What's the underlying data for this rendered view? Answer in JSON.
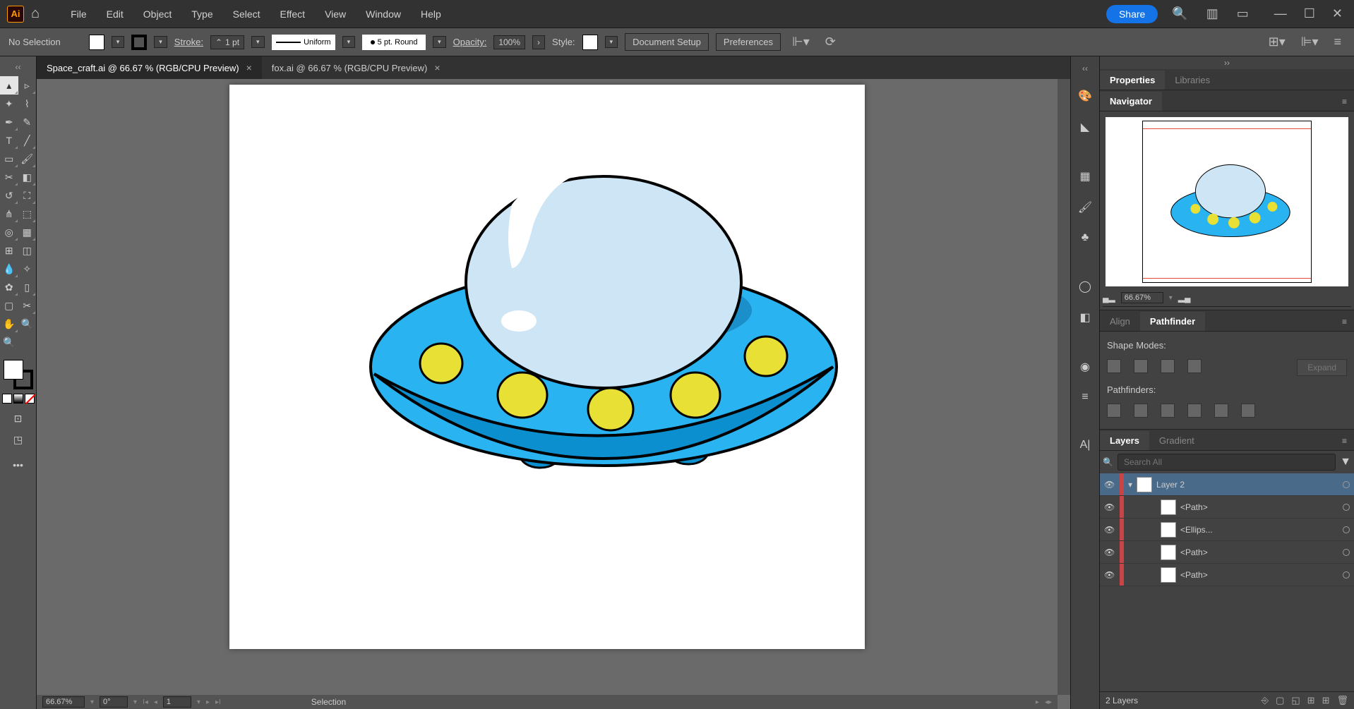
{
  "menubar": {
    "items": [
      "File",
      "Edit",
      "Object",
      "Type",
      "Select",
      "Effect",
      "View",
      "Window",
      "Help"
    ],
    "share": "Share"
  },
  "controlbar": {
    "selection": "No Selection",
    "stroke_label": "Stroke:",
    "stroke_weight": "1 pt",
    "stroke_profile": "Uniform",
    "brush": "5 pt. Round",
    "opacity_label": "Opacity:",
    "opacity": "100%",
    "style_label": "Style:",
    "doc_setup": "Document Setup",
    "prefs": "Preferences"
  },
  "tabs": [
    {
      "label": "Space_craft.ai @ 66.67 % (RGB/CPU Preview)",
      "active": true
    },
    {
      "label": "fox.ai @ 66.67 % (RGB/CPU Preview)",
      "active": false
    }
  ],
  "statusbar": {
    "zoom": "66.67%",
    "rotate": "0°",
    "artboard": "1",
    "tool": "Selection"
  },
  "panels": {
    "prop_tab": "Properties",
    "lib_tab": "Libraries",
    "nav_tab": "Navigator",
    "nav_zoom": "66.67%",
    "align_tab": "Align",
    "pathfinder_tab": "Pathfinder",
    "shape_modes": "Shape Modes:",
    "expand": "Expand",
    "pathfinders": "Pathfinders:",
    "layers_tab": "Layers",
    "gradient_tab": "Gradient",
    "search_ph": "Search All",
    "layer_count": "2 Layers",
    "layers": [
      {
        "name": "Layer 2",
        "sel": true,
        "indent": 0,
        "expand": true
      },
      {
        "name": "<Path>",
        "sel": false,
        "indent": 1
      },
      {
        "name": "<Ellips...",
        "sel": false,
        "indent": 1
      },
      {
        "name": "<Path>",
        "sel": false,
        "indent": 1
      },
      {
        "name": "<Path>",
        "sel": false,
        "indent": 1
      }
    ]
  }
}
